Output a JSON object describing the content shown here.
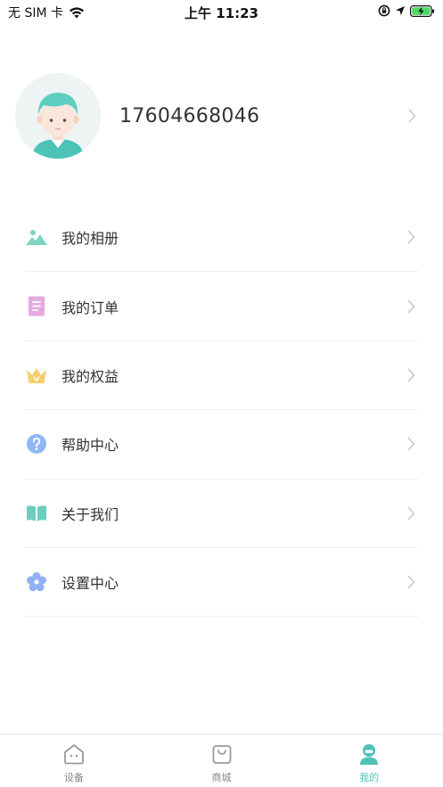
{
  "status_bar": {
    "carrier": "无 SIM 卡",
    "time": "上午 11:23"
  },
  "profile": {
    "phone": "17604668046"
  },
  "menu": {
    "items": [
      {
        "label": "我的相册",
        "icon": "mountain-photo-icon",
        "color": "#7fd3c5"
      },
      {
        "label": "我的订单",
        "icon": "document-list-icon",
        "color": "#e5a8e0"
      },
      {
        "label": "我的权益",
        "icon": "crown-icon",
        "color": "#f5cf6b"
      },
      {
        "label": "帮助中心",
        "icon": "help-question-icon",
        "color": "#8fb8f5"
      },
      {
        "label": "关于我们",
        "icon": "open-book-icon",
        "color": "#6fcdbf"
      },
      {
        "label": "设置中心",
        "icon": "flower-settings-icon",
        "color": "#8fb3f5"
      }
    ]
  },
  "tab_bar": {
    "tabs": [
      {
        "label": "设备",
        "icon": "home-device-icon",
        "active": false
      },
      {
        "label": "商城",
        "icon": "shopping-bag-icon",
        "active": false
      },
      {
        "label": "我的",
        "icon": "user-profile-icon",
        "active": true
      }
    ]
  },
  "colors": {
    "accent": "#4dc3b8",
    "divider": "#eeeeee",
    "chevron": "#c8c8c8"
  }
}
